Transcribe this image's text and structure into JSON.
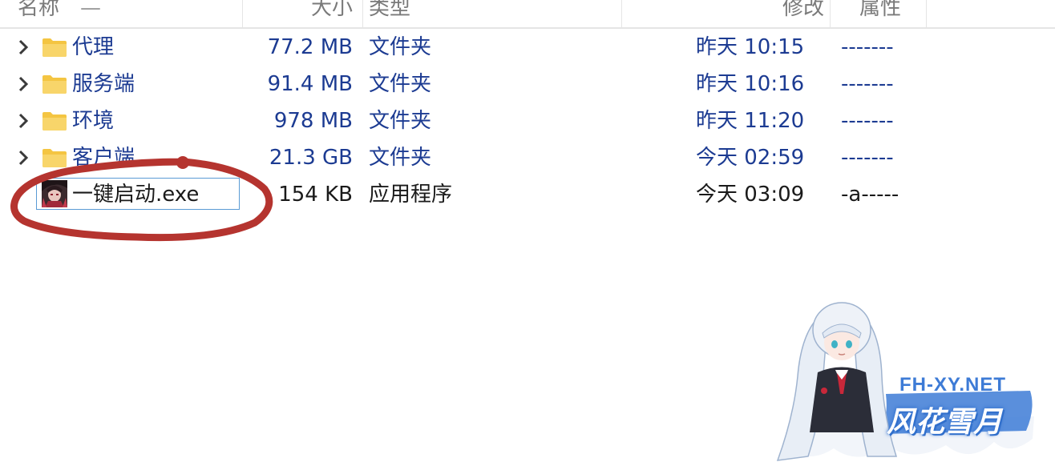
{
  "header": {
    "col_name": "名称",
    "col_size": "大小",
    "col_type": "类型",
    "col_modified": "修改",
    "col_attr": "属性"
  },
  "rows": [
    {
      "name": "代理",
      "size": "77.2 MB",
      "type": "文件夹",
      "modified": "昨天 10:15",
      "attr": "-------",
      "icon": "folder-icon"
    },
    {
      "name": "服务端",
      "size": "91.4 MB",
      "type": "文件夹",
      "modified": "昨天 10:16",
      "attr": "-------",
      "icon": "folder-icon"
    },
    {
      "name": "环境",
      "size": "978 MB",
      "type": "文件夹",
      "modified": "昨天 11:20",
      "attr": "-------",
      "icon": "folder-icon"
    },
    {
      "name": "客户端",
      "size": "21.3 GB",
      "type": "文件夹",
      "modified": "今天 02:59",
      "attr": "-------",
      "icon": "folder-icon"
    },
    {
      "name": "一键启动.exe",
      "size": "154 KB",
      "type": "应用程序",
      "modified": "今天 03:09",
      "attr": "-a-----",
      "icon": "exe-app-icon"
    }
  ],
  "watermark": {
    "url": "FH-XY.NET",
    "brand": "风花雪月"
  },
  "colors": {
    "folder_text": "#1c3b92",
    "annotation": "#b5342f",
    "folder_icon": "#f4c542",
    "watermark_blue": "#3d7bd6"
  }
}
